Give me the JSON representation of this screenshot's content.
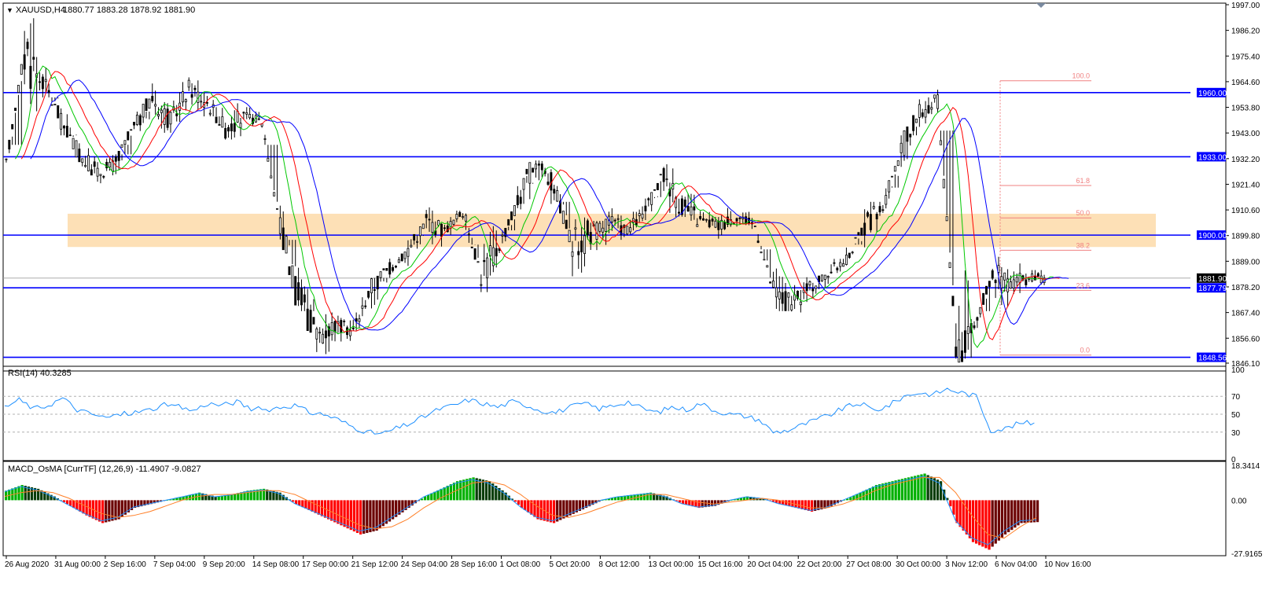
{
  "colors": {
    "background": "#ffffff",
    "frame": "#000000",
    "level_line": "#0000ff",
    "zone_fill": "#fde0b6",
    "fib": "#f08080",
    "ma_fast": "#00c800",
    "ma_mid": "#ff0000",
    "ma_slow": "#0000ff",
    "rsi_line": "#1e90ff",
    "macd_pos_strong": "#00b000",
    "macd_pos_weak": "#0a3d0a",
    "macd_neg_strong": "#ff0000",
    "macd_neg_weak": "#6b0000",
    "macd_line_a": "#1e90ff",
    "macd_line_b": "#ff7f27",
    "price_tag_current": "#000000",
    "price_tag_level": "#0000ff"
  },
  "header": {
    "symbol_label": "XAUUSD,H4",
    "ohlc": "1880.77 1883.28 1878.92 1881.90",
    "collapse_icon": "triangle-down-icon"
  },
  "chart_data": [
    {
      "type": "candlestick",
      "title": "XAUUSD,H4",
      "ylim": [
        1846.1,
        1997.0
      ],
      "y_ticks": [
        "1997.00",
        "1986.20",
        "1975.40",
        "1964.60",
        "1953.80",
        "1943.00",
        "1932.20",
        "1921.40",
        "1910.60",
        "1899.80",
        "1889.00",
        "1878.20",
        "1867.40",
        "1856.60",
        "1846.10"
      ],
      "x_ticks": [
        "26 Aug 2020",
        "31 Aug 00:00",
        "2 Sep 16:00",
        "7 Sep 04:00",
        "9 Sep 20:00",
        "14 Sep 08:00",
        "17 Sep 00:00",
        "21 Sep 12:00",
        "24 Sep 04:00",
        "28 Sep 16:00",
        "1 Oct 08:00",
        "5 Oct 20:00",
        "8 Oct 12:00",
        "13 Oct 00:00",
        "15 Oct 16:00",
        "20 Oct 04:00",
        "22 Oct 20:00",
        "27 Oct 08:00",
        "30 Oct 00:00",
        "3 Nov 12:00",
        "6 Nov 04:00",
        "10 Nov 16:00"
      ],
      "key_prices": [
        [
          1928,
          1936,
          1922,
          1930
        ],
        [
          1934,
          1992,
          1918,
          1978
        ],
        [
          1976,
          1983,
          1960,
          1965
        ],
        [
          1962,
          1965,
          1944,
          1948
        ],
        [
          1946,
          1950,
          1928,
          1934
        ],
        [
          1934,
          1938,
          1922,
          1926
        ],
        [
          1926,
          1932,
          1908,
          1930
        ],
        [
          1930,
          1950,
          1928,
          1945
        ],
        [
          1944,
          1968,
          1940,
          1958
        ],
        [
          1958,
          1964,
          1942,
          1948
        ],
        [
          1948,
          1966,
          1944,
          1962
        ],
        [
          1962,
          1972,
          1952,
          1956
        ],
        [
          1956,
          1962,
          1938,
          1945
        ],
        [
          1945,
          1952,
          1940,
          1950
        ],
        [
          1950,
          1954,
          1940,
          1948
        ],
        [
          1948,
          1950,
          1900,
          1904
        ],
        [
          1904,
          1908,
          1870,
          1874
        ],
        [
          1874,
          1880,
          1850,
          1858
        ],
        [
          1858,
          1866,
          1849,
          1862
        ],
        [
          1862,
          1872,
          1856,
          1860
        ],
        [
          1860,
          1880,
          1852,
          1878
        ],
        [
          1878,
          1890,
          1874,
          1886
        ],
        [
          1886,
          1898,
          1880,
          1894
        ],
        [
          1894,
          1912,
          1890,
          1906
        ],
        [
          1906,
          1910,
          1898,
          1902
        ],
        [
          1902,
          1915,
          1898,
          1910
        ],
        [
          1910,
          1916,
          1878,
          1884
        ],
        [
          1884,
          1900,
          1882,
          1896
        ],
        [
          1896,
          1920,
          1892,
          1914
        ],
        [
          1914,
          1936,
          1910,
          1932
        ],
        [
          1932,
          1934,
          1916,
          1920
        ],
        [
          1920,
          1924,
          1884,
          1896
        ],
        [
          1896,
          1904,
          1880,
          1900
        ],
        [
          1900,
          1912,
          1894,
          1906
        ],
        [
          1906,
          1912,
          1898,
          1902
        ],
        [
          1902,
          1914,
          1898,
          1910
        ],
        [
          1910,
          1936,
          1906,
          1926
        ],
        [
          1926,
          1930,
          1906,
          1912
        ],
        [
          1912,
          1916,
          1900,
          1906
        ],
        [
          1906,
          1914,
          1898,
          1904
        ],
        [
          1904,
          1912,
          1900,
          1908
        ],
        [
          1908,
          1910,
          1896,
          1904
        ],
        [
          1904,
          1906,
          1870,
          1876
        ],
        [
          1876,
          1884,
          1862,
          1870
        ],
        [
          1870,
          1880,
          1864,
          1878
        ],
        [
          1878,
          1888,
          1874,
          1884
        ],
        [
          1884,
          1894,
          1880,
          1890
        ],
        [
          1890,
          1912,
          1886,
          1904
        ],
        [
          1904,
          1918,
          1900,
          1912
        ],
        [
          1912,
          1940,
          1908,
          1936
        ],
        [
          1936,
          1956,
          1932,
          1952
        ],
        [
          1952,
          1966,
          1946,
          1956
        ],
        [
          1956,
          1960,
          1850,
          1856
        ],
        [
          1856,
          1866,
          1850,
          1862
        ],
        [
          1862,
          1890,
          1860,
          1884
        ],
        [
          1884,
          1890,
          1872,
          1880
        ],
        [
          1880,
          1883.28,
          1878.92,
          1881.9
        ]
      ],
      "levels": [
        "1960.00",
        "1933.00",
        "1900.00",
        "1877.79",
        "1848.56"
      ],
      "current_price": "1881.90",
      "zone": [
        1895,
        1909
      ],
      "fibonacci": {
        "high": 1965.0,
        "low": 1849.5,
        "labels": [
          "100.0",
          "61.8",
          "50.0",
          "38.2",
          "23.6",
          "0.0"
        ],
        "ratios": [
          1.0,
          0.618,
          0.5,
          0.382,
          0.236,
          0.0
        ]
      },
      "moving_averages": [
        "fast",
        "mid",
        "slow"
      ]
    },
    {
      "type": "line",
      "title": "RSI(14) 40.3285",
      "ylim": [
        0,
        100
      ],
      "y_ticks": [
        "100",
        "70",
        "50",
        "30",
        "0"
      ],
      "levels": [
        70,
        50,
        30
      ],
      "key_values": [
        58,
        66,
        56,
        60,
        68,
        55,
        50,
        46,
        50,
        52,
        55,
        60,
        58,
        54,
        62,
        60,
        64,
        56,
        55,
        58,
        60,
        52,
        50,
        44,
        36,
        30,
        28,
        34,
        40,
        48,
        56,
        60,
        66,
        62,
        58,
        64,
        60,
        54,
        52,
        58,
        62,
        56,
        60,
        64,
        56,
        52,
        58,
        55,
        62,
        54,
        50,
        48,
        44,
        30,
        32,
        38,
        44,
        50,
        58,
        62,
        54,
        60,
        70,
        74,
        72,
        78,
        74,
        70,
        32,
        34,
        40,
        40.33
      ]
    },
    {
      "type": "bar",
      "title": "MACD_OsMA [CurrTF] (12,26,9) -11.4907 -9.0827",
      "ylim": [
        -27.9165,
        18.3414
      ],
      "y_ticks": [
        "18.3414",
        "0.00",
        "-27.9165"
      ],
      "key_values": [
        5,
        8,
        6,
        2,
        -3,
        -8,
        -12,
        -10,
        -4,
        -2,
        0,
        2,
        4,
        2,
        3,
        5,
        6,
        4,
        -2,
        -6,
        -10,
        -14,
        -18,
        -16,
        -10,
        -4,
        2,
        6,
        10,
        12,
        10,
        4,
        -4,
        -10,
        -12,
        -8,
        -4,
        0,
        2,
        3,
        4,
        2,
        -2,
        -4,
        -3,
        0,
        2,
        1,
        -2,
        -4,
        -6,
        -4,
        0,
        4,
        8,
        10,
        12,
        14,
        10,
        -12,
        -22,
        -26,
        -18,
        -12,
        -11.49
      ],
      "signal_values": [
        2,
        4,
        5,
        4,
        1,
        -3,
        -7,
        -9,
        -8,
        -6,
        -3,
        0,
        2,
        3,
        3,
        4,
        5,
        5,
        3,
        -1,
        -5,
        -9,
        -13,
        -15,
        -14,
        -10,
        -4,
        1,
        5,
        9,
        10,
        8,
        3,
        -3,
        -8,
        -9,
        -7,
        -4,
        -1,
        1,
        3,
        3,
        1,
        -1,
        -2,
        -1,
        0,
        1,
        0,
        -2,
        -4,
        -4,
        -2,
        1,
        5,
        8,
        10,
        12,
        12,
        4,
        -8,
        -18,
        -20,
        -14,
        -9.08
      ]
    }
  ]
}
